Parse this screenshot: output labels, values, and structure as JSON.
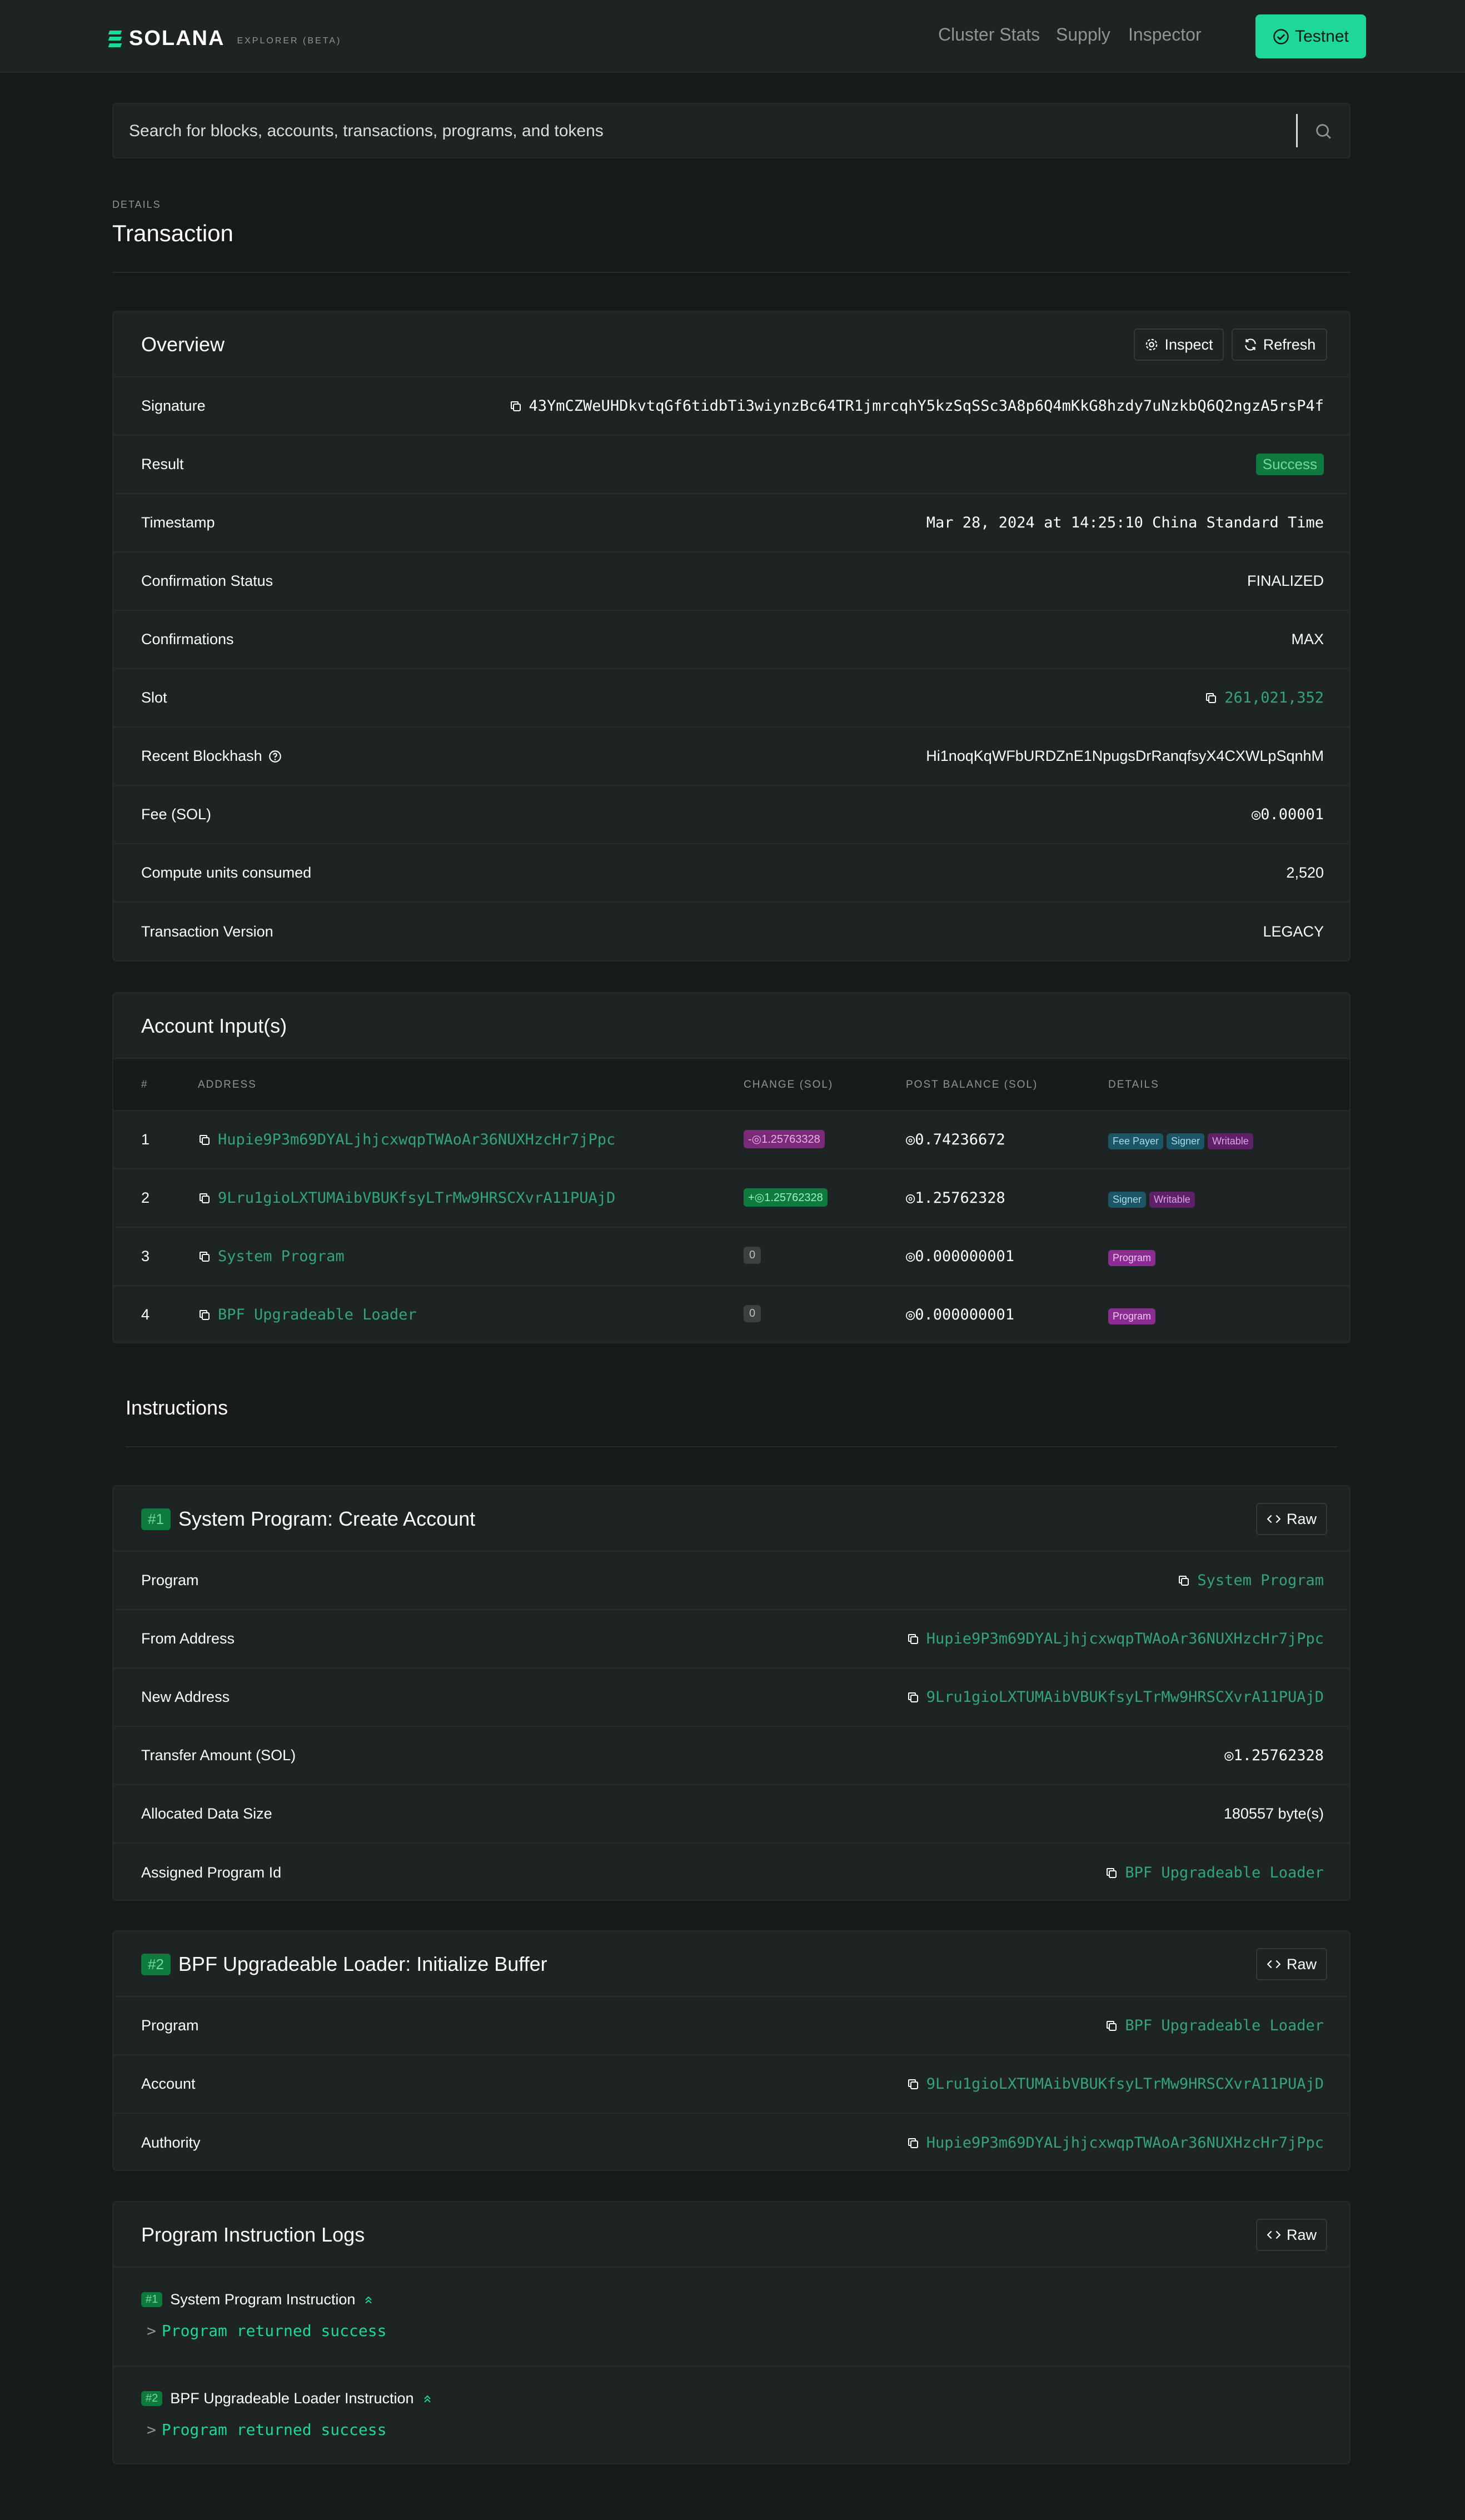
{
  "header": {
    "brand": "SOLANA",
    "brand_sub": "EXPLORER (BETA)",
    "nav": [
      "Cluster Stats",
      "Supply",
      "Inspector"
    ],
    "network_button": "Testnet"
  },
  "search": {
    "placeholder": "Search for blocks, accounts, transactions, programs, and tokens"
  },
  "page": {
    "pretitle": "DETAILS",
    "title": "Transaction"
  },
  "overview": {
    "title": "Overview",
    "inspect_label": "Inspect",
    "refresh_label": "Refresh",
    "rows": [
      {
        "label": "Signature",
        "value": "43YmCZWeUHDkvtqGf6tidbTi3wiynzBc64TR1jmrcqhY5kzSqSSc3A8p6Q4mKkG8hzdy7uNzkbQ6Q2ngzA5rsP4f"
      },
      {
        "label": "Result",
        "value": "Success"
      },
      {
        "label": "Timestamp",
        "value": "Mar 28, 2024 at 14:25:10 China Standard Time"
      },
      {
        "label": "Confirmation Status",
        "value": "FINALIZED"
      },
      {
        "label": "Confirmations",
        "value": "MAX"
      },
      {
        "label": "Slot",
        "value": "261,021,352"
      },
      {
        "label": "Recent Blockhash",
        "value": "Hi1noqKqWFbURDZnE1NpugsDrRanqfsyX4CXWLpSqnhM"
      },
      {
        "label": "Fee (SOL)",
        "value": "◎0.00001"
      },
      {
        "label": "Compute units consumed",
        "value": "2,520"
      },
      {
        "label": "Transaction Version",
        "value": "LEGACY"
      }
    ]
  },
  "accounts": {
    "title": "Account Input(s)",
    "columns": [
      "#",
      "ADDRESS",
      "CHANGE (SOL)",
      "POST BALANCE (SOL)",
      "DETAILS"
    ],
    "rows": [
      {
        "n": "1",
        "address": "Hupie9P3m69DYALjhjcxwqpTWAoAr36NUXHzcHr7jPpc",
        "change": "-◎1.25763328",
        "balance": "◎0.74236672",
        "tags": [
          "Fee Payer",
          "Signer",
          "Writable"
        ]
      },
      {
        "n": "2",
        "address": "9Lru1gioLXTUMAibVBUKfsyLTrMw9HRSCXvrA11PUAjD",
        "change": "+◎1.25762328",
        "balance": "◎1.25762328",
        "tags": [
          "Signer",
          "Writable"
        ]
      },
      {
        "n": "3",
        "address": "System Program",
        "change": "0",
        "balance": "◎0.000000001",
        "tags": [
          "Program"
        ]
      },
      {
        "n": "4",
        "address": "BPF Upgradeable Loader",
        "change": "0",
        "balance": "◎0.000000001",
        "tags": [
          "Program"
        ]
      }
    ]
  },
  "instructions": {
    "heading": "Instructions",
    "raw_label": "Raw",
    "ix1": {
      "num": "#1",
      "title": "System Program: Create Account",
      "rows": [
        {
          "label": "Program",
          "value": "System Program"
        },
        {
          "label": "From Address",
          "value": "Hupie9P3m69DYALjhjcxwqpTWAoAr36NUXHzcHr7jPpc"
        },
        {
          "label": "New Address",
          "value": "9Lru1gioLXTUMAibVBUKfsyLTrMw9HRSCXvrA11PUAjD"
        },
        {
          "label": "Transfer Amount (SOL)",
          "value": "◎1.25762328"
        },
        {
          "label": "Allocated Data Size",
          "value": "180557 byte(s)"
        },
        {
          "label": "Assigned Program Id",
          "value": "BPF Upgradeable Loader"
        }
      ]
    },
    "ix2": {
      "num": "#2",
      "title": "BPF Upgradeable Loader: Initialize Buffer",
      "rows": [
        {
          "label": "Program",
          "value": "BPF Upgradeable Loader"
        },
        {
          "label": "Account",
          "value": "9Lru1gioLXTUMAibVBUKfsyLTrMw9HRSCXvrA11PUAjD"
        },
        {
          "label": "Authority",
          "value": "Hupie9P3m69DYALjhjcxwqpTWAoAr36NUXHzcHr7jPpc"
        }
      ]
    }
  },
  "logs": {
    "title": "Program Instruction Logs",
    "raw_label": "Raw",
    "entries": [
      {
        "num": "#1",
        "name": "System Program Instruction",
        "line": "Program returned success"
      },
      {
        "num": "#2",
        "name": "BPF Upgradeable Loader Instruction",
        "line": "Program returned success"
      }
    ]
  },
  "colors": {
    "accent": "#1dd79b",
    "link": "#33a382",
    "background": "#161a19",
    "card": "#1e2423"
  }
}
